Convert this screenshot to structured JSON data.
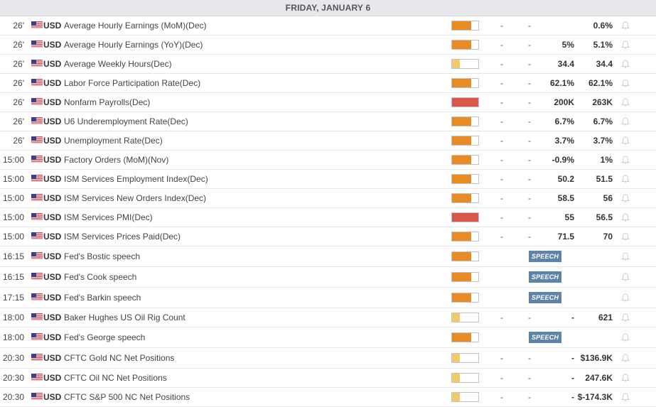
{
  "header": {
    "title": "FRIDAY, JANUARY 6"
  },
  "colors": {
    "high": "#d9574a",
    "medium": "#e88b25",
    "low": "#f3c96a",
    "speech_badge": "#5d84a8"
  },
  "rows": [
    {
      "time": "26'",
      "currency": "USD",
      "event": "Average Hourly Earnings (MoM)(Dec)",
      "impact": "medium",
      "actual": "-",
      "deviation": "-",
      "consensus": "",
      "previous": "0.6%",
      "type": "data"
    },
    {
      "time": "26'",
      "currency": "USD",
      "event": "Average Hourly Earnings (YoY)(Dec)",
      "impact": "medium",
      "actual": "-",
      "deviation": "-",
      "consensus": "5%",
      "previous": "5.1%",
      "type": "data"
    },
    {
      "time": "26'",
      "currency": "USD",
      "event": "Average Weekly Hours(Dec)",
      "impact": "low",
      "actual": "-",
      "deviation": "-",
      "consensus": "34.4",
      "previous": "34.4",
      "type": "data"
    },
    {
      "time": "26'",
      "currency": "USD",
      "event": "Labor Force Participation Rate(Dec)",
      "impact": "medium",
      "actual": "-",
      "deviation": "-",
      "consensus": "62.1%",
      "previous": "62.1%",
      "type": "data"
    },
    {
      "time": "26'",
      "currency": "USD",
      "event": "Nonfarm Payrolls(Dec)",
      "impact": "high",
      "actual": "-",
      "deviation": "-",
      "consensus": "200K",
      "previous": "263K",
      "type": "data"
    },
    {
      "time": "26'",
      "currency": "USD",
      "event": "U6 Underemployment Rate(Dec)",
      "impact": "medium",
      "actual": "-",
      "deviation": "-",
      "consensus": "6.7%",
      "previous": "6.7%",
      "type": "data"
    },
    {
      "time": "26'",
      "currency": "USD",
      "event": "Unemployment Rate(Dec)",
      "impact": "medium",
      "actual": "-",
      "deviation": "-",
      "consensus": "3.7%",
      "previous": "3.7%",
      "type": "data"
    },
    {
      "time": "15:00",
      "currency": "USD",
      "event": "Factory Orders (MoM)(Nov)",
      "impact": "medium",
      "actual": "-",
      "deviation": "-",
      "consensus": "-0.9%",
      "previous": "1%",
      "type": "data"
    },
    {
      "time": "15:00",
      "currency": "USD",
      "event": "ISM Services Employment Index(Dec)",
      "impact": "medium",
      "actual": "-",
      "deviation": "-",
      "consensus": "50.2",
      "previous": "51.5",
      "type": "data"
    },
    {
      "time": "15:00",
      "currency": "USD",
      "event": "ISM Services New Orders Index(Dec)",
      "impact": "medium",
      "actual": "-",
      "deviation": "-",
      "consensus": "58.5",
      "previous": "56",
      "type": "data"
    },
    {
      "time": "15:00",
      "currency": "USD",
      "event": "ISM Services PMI(Dec)",
      "impact": "high",
      "actual": "-",
      "deviation": "-",
      "consensus": "55",
      "previous": "56.5",
      "type": "data"
    },
    {
      "time": "15:00",
      "currency": "USD",
      "event": "ISM Services Prices Paid(Dec)",
      "impact": "medium",
      "actual": "-",
      "deviation": "-",
      "consensus": "71.5",
      "previous": "70",
      "type": "data"
    },
    {
      "time": "16:15",
      "currency": "USD",
      "event": "Fed's Bostic speech",
      "impact": "medium",
      "badge": "SPEECH",
      "type": "speech"
    },
    {
      "time": "16:15",
      "currency": "USD",
      "event": "Fed's Cook speech",
      "impact": "medium",
      "badge": "SPEECH",
      "type": "speech"
    },
    {
      "time": "17:15",
      "currency": "USD",
      "event": "Fed's Barkin speech",
      "impact": "medium",
      "badge": "SPEECH",
      "type": "speech"
    },
    {
      "time": "18:00",
      "currency": "USD",
      "event": "Baker Hughes US Oil Rig Count",
      "impact": "low",
      "actual": "-",
      "deviation": "-",
      "consensus": "-",
      "previous": "621",
      "type": "data"
    },
    {
      "time": "18:00",
      "currency": "USD",
      "event": "Fed's George speech",
      "impact": "medium",
      "badge": "SPEECH",
      "type": "speech"
    },
    {
      "time": "20:30",
      "currency": "USD",
      "event": "CFTC Gold NC Net Positions",
      "impact": "low",
      "actual": "-",
      "deviation": "-",
      "consensus": "-",
      "previous": "$136.9K",
      "type": "data"
    },
    {
      "time": "20:30",
      "currency": "USD",
      "event": "CFTC Oil NC Net Positions",
      "impact": "low",
      "actual": "-",
      "deviation": "-",
      "consensus": "-",
      "previous": "247.6K",
      "type": "data"
    },
    {
      "time": "20:30",
      "currency": "USD",
      "event": "CFTC S&P 500 NC Net Positions",
      "impact": "low",
      "actual": "-",
      "deviation": "-",
      "consensus": "-",
      "previous": "$-174.3K",
      "type": "data"
    }
  ]
}
